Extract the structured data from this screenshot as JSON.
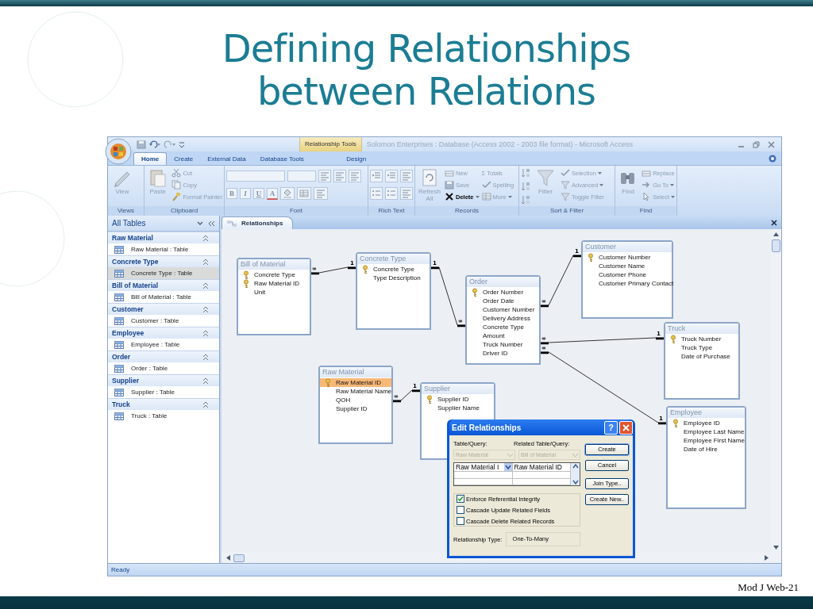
{
  "slide": {
    "title": [
      "Defining Relationships",
      "between Relations"
    ],
    "footer": "Mod J Web-21"
  },
  "window": {
    "contextual_tab": "Relationship Tools",
    "title": "Solomon Enterprises : Database (Access 2002 - 2003 file format) - Microsoft Access"
  },
  "tabs": [
    {
      "label": "Home",
      "selected": true
    },
    {
      "label": "Create",
      "selected": false
    },
    {
      "label": "External Data",
      "selected": false
    },
    {
      "label": "Database Tools",
      "selected": false
    },
    {
      "label": "Design",
      "selected": false
    }
  ],
  "ribbon": [
    {
      "label": "Views",
      "kind": "buttons",
      "large": [
        {
          "label": "View",
          "disabled": true
        }
      ]
    },
    {
      "label": "Clipboard",
      "kind": "buttons",
      "large": [
        {
          "label": "Paste",
          "disabled": true
        }
      ],
      "small": [
        {
          "label": "Cut",
          "disabled": true
        },
        {
          "label": "Copy",
          "disabled": true
        },
        {
          "label": "Format Painter",
          "disabled": true
        }
      ]
    },
    {
      "label": "Font",
      "kind": "font",
      "format": [
        {
          "label": "B",
          "disabled": true
        },
        {
          "label": "I",
          "disabled": true
        },
        {
          "label": "U",
          "disabled": true
        },
        {
          "label": "A",
          "disabled": true
        }
      ]
    },
    {
      "label": "Rich Text",
      "kind": "icons"
    },
    {
      "label": "Records",
      "kind": "buttons",
      "large": [
        {
          "label": "Refresh All",
          "disabled": true
        }
      ],
      "small": [
        {
          "label": "New",
          "disabled": true
        },
        {
          "label": "Save",
          "disabled": true
        },
        {
          "label": "Delete",
          "disabled": false,
          "menu": true
        },
        {
          "label": "Σ Totals",
          "disabled": true
        },
        {
          "label": "Spelling",
          "disabled": true
        },
        {
          "label": "More",
          "disabled": true,
          "menu": true
        }
      ]
    },
    {
      "label": "Sort & Filter",
      "kind": "sort",
      "large": [
        {
          "label": "Filter",
          "disabled": true
        }
      ],
      "small": [
        {
          "label": "Selection",
          "disabled": true,
          "menu": true
        },
        {
          "label": "Advanced",
          "disabled": true,
          "menu": true
        },
        {
          "label": "Toggle Filter",
          "disabled": true
        }
      ]
    },
    {
      "label": "Find",
      "kind": "buttons",
      "large": [
        {
          "label": "Find",
          "disabled": true
        }
      ],
      "small": [
        {
          "label": "Replace",
          "disabled": true
        },
        {
          "label": "Go To",
          "disabled": true,
          "menu": true
        },
        {
          "label": "Select",
          "disabled": true,
          "menu": true
        }
      ]
    }
  ],
  "navigation": {
    "title": "All Tables",
    "groups": [
      {
        "title": "Raw Material",
        "expanded": true,
        "items": [
          {
            "label": "Raw Material : Table",
            "selected": false
          }
        ]
      },
      {
        "title": "Concrete Type",
        "expanded": true,
        "items": [
          {
            "label": "Concrete Type : Table",
            "selected": true
          }
        ]
      },
      {
        "title": "Bill of Material",
        "expanded": true,
        "items": [
          {
            "label": "Bill of Material : Table",
            "selected": false
          }
        ]
      },
      {
        "title": "Customer",
        "expanded": true,
        "items": [
          {
            "label": "Customer : Table",
            "selected": false
          }
        ]
      },
      {
        "title": "Employee",
        "expanded": true,
        "items": [
          {
            "label": "Employee : Table",
            "selected": false
          }
        ]
      },
      {
        "title": "Order",
        "expanded": true,
        "items": [
          {
            "label": "Order : Table",
            "selected": false
          }
        ]
      },
      {
        "title": "Supplier",
        "expanded": true,
        "items": [
          {
            "label": "Supplier : Table",
            "selected": false
          }
        ]
      },
      {
        "title": "Truck",
        "expanded": true,
        "items": [
          {
            "label": "Truck : Table",
            "selected": false
          }
        ]
      }
    ]
  },
  "document_tab": "Relationships",
  "tables": [
    {
      "name": "Bill of Material",
      "fields": [
        {
          "name": "Concrete Type",
          "key": true,
          "selected": false
        },
        {
          "name": "Raw Material ID",
          "key": true,
          "selected": false
        },
        {
          "name": "Unit",
          "key": false,
          "selected": false
        }
      ]
    },
    {
      "name": "Concrete Type",
      "fields": [
        {
          "name": "Concrete Type",
          "key": true,
          "selected": false
        },
        {
          "name": "Type Description",
          "key": false,
          "selected": false
        }
      ]
    },
    {
      "name": "Order",
      "fields": [
        {
          "name": "Order Number",
          "key": true,
          "selected": false
        },
        {
          "name": "Order Date",
          "key": false,
          "selected": false
        },
        {
          "name": "Customer Number",
          "key": false,
          "selected": false
        },
        {
          "name": "Delivery Address",
          "key": false,
          "selected": false
        },
        {
          "name": "Concrete Type",
          "key": false,
          "selected": false
        },
        {
          "name": "Amount",
          "key": false,
          "selected": false
        },
        {
          "name": "Truck Number",
          "key": false,
          "selected": false
        },
        {
          "name": "Driver ID",
          "key": false,
          "selected": false
        }
      ]
    },
    {
      "name": "Customer",
      "fields": [
        {
          "name": "Customer Number",
          "key": true,
          "selected": false
        },
        {
          "name": "Customer Name",
          "key": false,
          "selected": false
        },
        {
          "name": "Customer Phone",
          "key": false,
          "selected": false
        },
        {
          "name": "Customer Primary Contact",
          "key": false,
          "selected": false
        }
      ]
    },
    {
      "name": "Truck",
      "fields": [
        {
          "name": "Truck Number",
          "key": true,
          "selected": false
        },
        {
          "name": "Truck Type",
          "key": false,
          "selected": false
        },
        {
          "name": "Date of Purchase",
          "key": false,
          "selected": false
        }
      ]
    },
    {
      "name": "Raw Material",
      "fields": [
        {
          "name": "Raw Material ID",
          "key": true,
          "selected": true
        },
        {
          "name": "Raw Material Name",
          "key": false,
          "selected": false
        },
        {
          "name": "QOH",
          "key": false,
          "selected": false
        },
        {
          "name": "Supplier ID",
          "key": false,
          "selected": false
        }
      ]
    },
    {
      "name": "Supplier",
      "fields": [
        {
          "name": "Supplier ID",
          "key": true,
          "selected": false
        },
        {
          "name": "Supplier Name",
          "key": false,
          "selected": false
        }
      ]
    },
    {
      "name": "Employee",
      "fields": [
        {
          "name": "Employee ID",
          "key": true,
          "selected": false
        },
        {
          "name": "Employee Last Name",
          "key": false,
          "selected": false
        },
        {
          "name": "Employee First Name",
          "key": false,
          "selected": false
        },
        {
          "name": "Date of Hire",
          "key": false,
          "selected": false
        }
      ]
    }
  ],
  "relationships": [
    {
      "many": "∞",
      "one": "1"
    },
    {
      "many": "∞",
      "one": "1"
    },
    {
      "many": "∞",
      "one": "1"
    },
    {
      "many": "∞",
      "one": "1"
    },
    {
      "many": "∞",
      "one": "1"
    },
    {
      "many": "∞",
      "one": "1"
    }
  ],
  "dialog": {
    "title": "Edit Relationships",
    "help": "?",
    "table_label": "Table/Query:",
    "related_label": "Related Table/Query:",
    "table": "Raw Material",
    "related_table": "Bill of Material",
    "join_rows": [
      {
        "field": "Raw Material I",
        "related_field": "Raw Material ID"
      }
    ],
    "options": [
      {
        "label": "Enforce Referential Integrity",
        "checked": true
      },
      {
        "label": "Cascade Update Related Fields",
        "checked": false
      },
      {
        "label": "Cascade Delete Related Records",
        "checked": false
      }
    ],
    "type_label": "Relationship Type:",
    "type": "One-To-Many",
    "buttons": [
      {
        "label": "Create",
        "default": true
      },
      {
        "label": "Cancel",
        "default": false
      },
      {
        "label": "Join Type..",
        "default": false
      },
      {
        "label": "Create New..",
        "default": false
      }
    ]
  },
  "status_bar": "Ready"
}
